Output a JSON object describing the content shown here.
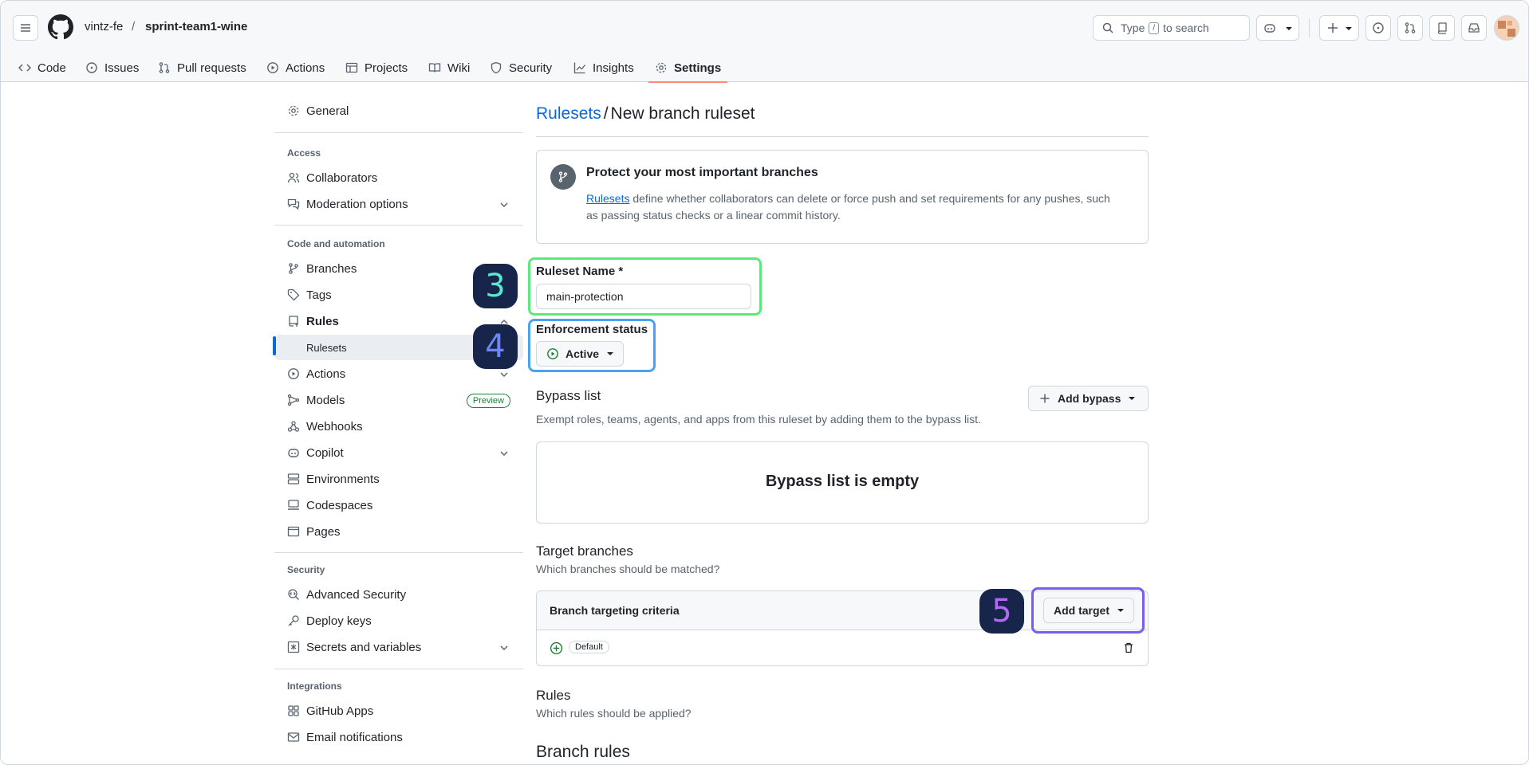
{
  "header": {
    "owner": "vintz-fe",
    "separator": "/",
    "repo": "sprint-team1-wine",
    "search_prefix": "Type",
    "search_key": "/",
    "search_suffix": "to search"
  },
  "tabs": [
    {
      "label": "Code",
      "icon": "code-icon"
    },
    {
      "label": "Issues",
      "icon": "issue-icon"
    },
    {
      "label": "Pull requests",
      "icon": "pull-request-icon"
    },
    {
      "label": "Actions",
      "icon": "play-icon"
    },
    {
      "label": "Projects",
      "icon": "table-icon"
    },
    {
      "label": "Wiki",
      "icon": "book-icon"
    },
    {
      "label": "Security",
      "icon": "shield-icon"
    },
    {
      "label": "Insights",
      "icon": "graph-icon"
    },
    {
      "label": "Settings",
      "icon": "gear-icon",
      "active": true
    }
  ],
  "sidebar": {
    "general": "General",
    "access_heading": "Access",
    "collaborators": "Collaborators",
    "moderation": "Moderation options",
    "code_heading": "Code and automation",
    "branches": "Branches",
    "tags": "Tags",
    "rules": "Rules",
    "rulesets": "Rulesets",
    "actions": "Actions",
    "models": "Models",
    "models_badge": "Preview",
    "webhooks": "Webhooks",
    "copilot": "Copilot",
    "environments": "Environments",
    "codespaces": "Codespaces",
    "pages": "Pages",
    "security_heading": "Security",
    "advanced_security": "Advanced Security",
    "deploy_keys": "Deploy keys",
    "secrets": "Secrets and variables",
    "integrations_heading": "Integrations",
    "github_apps": "GitHub Apps",
    "email_notifications": "Email notifications"
  },
  "main": {
    "title_link": "Rulesets",
    "title_sep": "/",
    "title_rest": "New branch ruleset",
    "blank": {
      "heading": "Protect your most important branches",
      "link": "Rulesets",
      "body_line1": "define whether collaborators can delete or force push and set requirements for any pushes, such",
      "body_line2": "as passing status checks or a linear commit history."
    },
    "name_label": "Ruleset Name *",
    "name_value": "main-protection",
    "enforcement_label": "Enforcement status",
    "enforcement_value": "Active",
    "bypass_heading": "Bypass list",
    "bypass_desc": "Exempt roles, teams, agents, and apps from this ruleset by adding them to the bypass list.",
    "add_bypass": "Add bypass",
    "bypass_empty": "Bypass list is empty",
    "target_heading": "Target branches",
    "target_desc": "Which branches should be matched?",
    "criteria_label": "Branch targeting criteria",
    "add_target": "Add target",
    "default_pill": "Default",
    "rules_heading": "Rules",
    "rules_desc": "Which rules should be applied?",
    "branch_rules_heading": "Branch rules"
  },
  "annotations": {
    "step3": "3",
    "step4": "4",
    "step5": "5",
    "color3": "#5ce87a",
    "color4": "#4aa3f0",
    "color5": "#7a5cf0"
  }
}
